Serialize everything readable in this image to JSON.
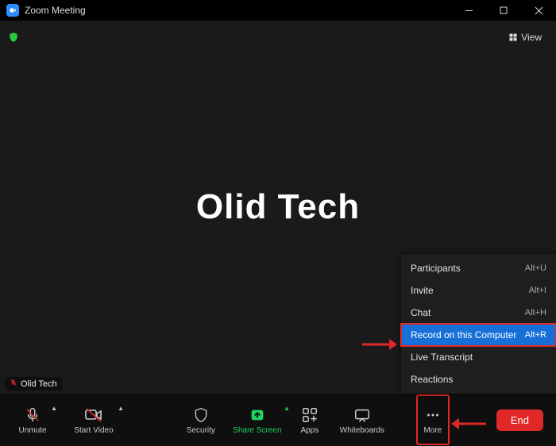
{
  "window": {
    "title": "Zoom Meeting"
  },
  "topbar": {
    "view_label": "View"
  },
  "stage": {
    "display_name": "Olid Tech"
  },
  "participant_tag": {
    "name": "Olid Tech"
  },
  "toolbar": {
    "unmute": "Unmute",
    "start_video": "Start Video",
    "security": "Security",
    "share_screen": "Share Screen",
    "apps": "Apps",
    "whiteboards": "Whiteboards",
    "more": "More",
    "end": "End"
  },
  "menu": {
    "items": [
      {
        "label": "Participants",
        "shortcut": "Alt+U",
        "selected": false
      },
      {
        "label": "Invite",
        "shortcut": "Alt+I",
        "selected": false
      },
      {
        "label": "Chat",
        "shortcut": "Alt+H",
        "selected": false
      },
      {
        "label": "Record on this Computer",
        "shortcut": "Alt+R",
        "selected": true
      },
      {
        "label": "Live Transcript",
        "shortcut": "",
        "selected": false
      },
      {
        "label": "Reactions",
        "shortcut": "",
        "selected": false
      }
    ]
  }
}
